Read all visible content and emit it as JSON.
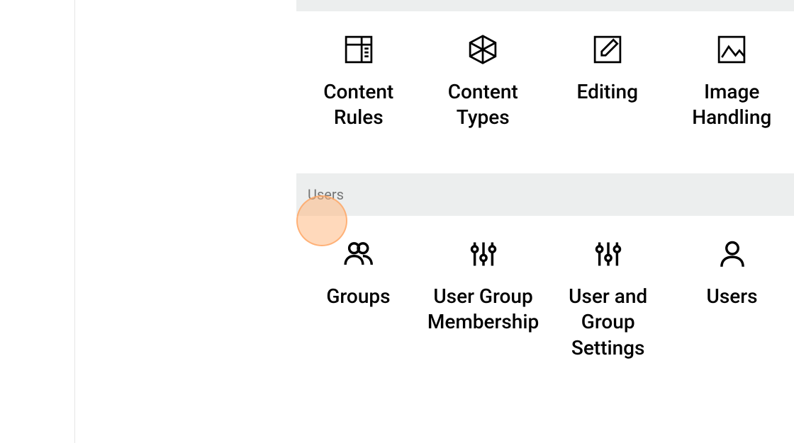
{
  "sections": [
    {
      "title": "",
      "items": [
        {
          "label": "Content Rules",
          "icon": "newspaper"
        },
        {
          "label": "Content Types",
          "icon": "cube"
        },
        {
          "label": "Editing",
          "icon": "edit"
        },
        {
          "label": "Image Handling",
          "icon": "image"
        }
      ]
    },
    {
      "title": "Users",
      "items": [
        {
          "label": "Groups",
          "icon": "users"
        },
        {
          "label": "User Group Membership",
          "icon": "sliders"
        },
        {
          "label": "User and Group Settings",
          "icon": "sliders"
        },
        {
          "label": "Users",
          "icon": "user"
        }
      ]
    }
  ]
}
